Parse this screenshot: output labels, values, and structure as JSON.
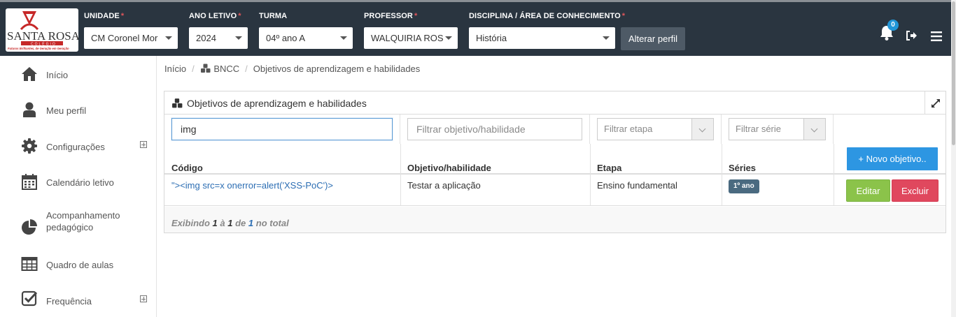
{
  "colors": {
    "topbar": "#2a3540",
    "accent": "#2d96e2",
    "edit": "#8bc34a",
    "delete": "#e0485e",
    "badge": "#4a6a80",
    "link": "#2b6db3"
  },
  "logo": {
    "line1": "SANTA ROSA",
    "line2": "COLÉGIO",
    "tagline": "Futuros Brilhantes, de Geração em Geração"
  },
  "filters": [
    {
      "label": "UNIDADE",
      "required": "*",
      "value": "CM Coronel Mor"
    },
    {
      "label": "ANO LETIVO",
      "required": "*",
      "value": "2024"
    },
    {
      "label": "TURMA",
      "required": "",
      "value": "04º ano A"
    },
    {
      "label": "PROFESSOR",
      "required": "*",
      "value": "WALQUIRIA ROS"
    },
    {
      "label": "DISCIPLINA / ÁREA DE CONHECIMENTO",
      "required": "*",
      "value": "História"
    }
  ],
  "header": {
    "change_profile": "Alterar perfil",
    "notification_count": "0",
    "icons": [
      "bell-icon",
      "sign-out-icon",
      "menu-icon"
    ]
  },
  "sidebar": {
    "items": [
      {
        "label": "Início",
        "icon": "home-icon"
      },
      {
        "label": "Meu perfil",
        "icon": "user-icon"
      },
      {
        "label": "Configurações",
        "icon": "gear-icon",
        "expandable": true
      },
      {
        "label": "Calendário letivo",
        "icon": "calendar-icon"
      },
      {
        "label": "Acompanhamento pedagógico",
        "icon": "pie-chart-icon"
      },
      {
        "label": "Quadro de aulas",
        "icon": "table-icon"
      },
      {
        "label": "Frequência",
        "icon": "check-square-icon",
        "expandable": true
      }
    ]
  },
  "breadcrumb": {
    "home": "Início",
    "section": "BNCC",
    "current": "Objetivos de aprendizagem e habilidades"
  },
  "panel": {
    "title": "Objetivos de aprendizagem e habilidades",
    "filters": {
      "code_value": "img",
      "objective_placeholder": "Filtrar objetivo/habilidade",
      "stage_placeholder": "Filtrar etapa",
      "series_placeholder": "Filtrar série"
    },
    "columns": {
      "code": "Código",
      "objective": "Objetivo/habilidade",
      "stage": "Etapa",
      "series": "Séries"
    },
    "new_button": "+ Novo objetivo..",
    "rows": [
      {
        "code": "\"><img src=x onerror=alert('XSS-PoC')>",
        "objective": "Testar a aplicação",
        "stage": "Ensino fundamental",
        "series": "1º ano",
        "edit": "Editar",
        "delete": "Excluir"
      }
    ],
    "footer": {
      "prefix": "Exibindo",
      "from": "1",
      "a": "à",
      "to": "1",
      "de": "de",
      "total": "1",
      "suffix": "no total"
    }
  }
}
